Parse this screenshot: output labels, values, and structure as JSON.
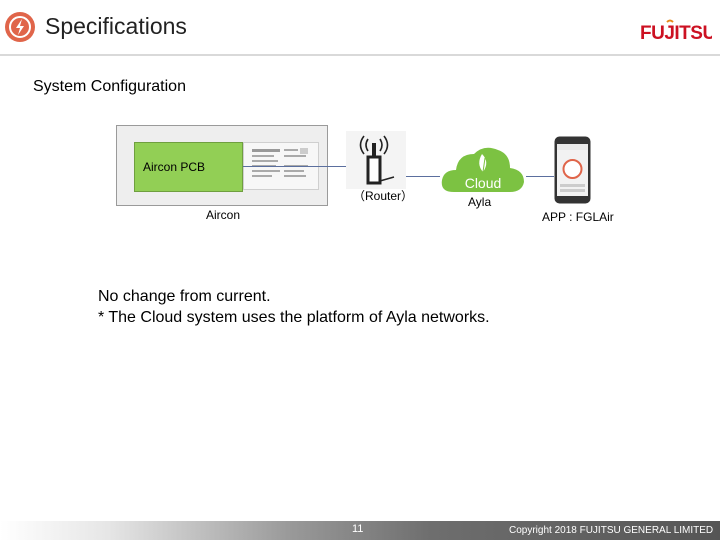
{
  "header": {
    "title": "Specifications",
    "brand": "FUJITSU"
  },
  "section_title": "System Configuration",
  "diagram": {
    "pcb_label": "Aircon PCB",
    "aircon_label": "Aircon",
    "router_label": "（Router）",
    "cloud_text": "Cloud",
    "ayla_label": "Ayla",
    "app_label": "APP : FGLAir"
  },
  "body": {
    "line1": "No change from current.",
    "line2": "* The Cloud system uses the platform of Ayla networks."
  },
  "footer": {
    "page_number": "11",
    "copyright": "Copyright 2018 FUJITSU GENERAL LIMITED"
  },
  "colors": {
    "accent": "#e0654a",
    "brand_red": "#cc1122",
    "pcb_green": "#92cf55",
    "cloud_green": "#7cc242"
  }
}
